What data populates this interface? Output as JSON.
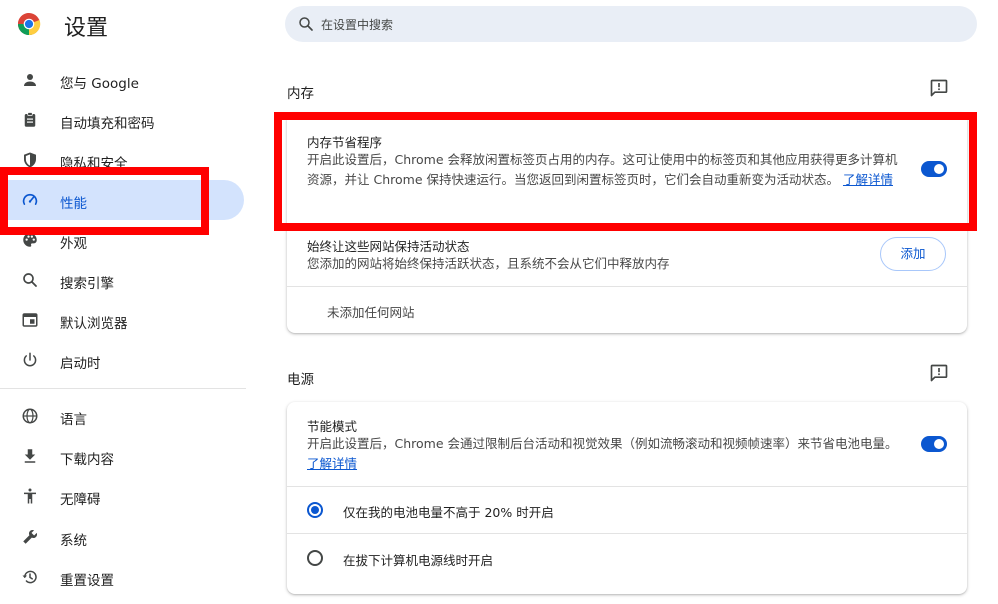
{
  "header": {
    "title": "设置",
    "search_placeholder": "在设置中搜索"
  },
  "sidebar": {
    "items": [
      {
        "label": "您与 Google",
        "icon": "person-icon"
      },
      {
        "label": "自动填充和密码",
        "icon": "clipboard-icon"
      },
      {
        "label": "隐私和安全",
        "icon": "shield-icon"
      },
      {
        "label": "性能",
        "icon": "speedometer-icon",
        "active": true
      },
      {
        "label": "外观",
        "icon": "palette-icon"
      },
      {
        "label": "搜索引擎",
        "icon": "search-icon"
      },
      {
        "label": "默认浏览器",
        "icon": "browser-window-icon"
      },
      {
        "label": "启动时",
        "icon": "power-icon"
      },
      {
        "label": "语言",
        "icon": "globe-icon"
      },
      {
        "label": "下载内容",
        "icon": "download-icon"
      },
      {
        "label": "无障碍",
        "icon": "accessibility-icon"
      },
      {
        "label": "系统",
        "icon": "wrench-icon"
      },
      {
        "label": "重置设置",
        "icon": "history-reset-icon"
      }
    ]
  },
  "memory": {
    "section_title": "内存",
    "saver": {
      "title": "内存节省程序",
      "description": "开启此设置后，Chrome 会释放闲置标签页占用的内存。这可让使用中的标签页和其他应用获得更多计算机资源，并让 Chrome 保持快速运行。当您返回到闲置标签页时，它们会自动重新变为活动状态。",
      "link": "了解详情",
      "enabled": true
    },
    "always_active": {
      "title": "始终让这些网站保持活动状态",
      "description": "您添加的网站将始终保持活跃状态，且系统不会从它们中释放内存",
      "add_label": "添加",
      "empty_text": "未添加任何网站"
    }
  },
  "power": {
    "section_title": "电源",
    "energy_saver": {
      "title": "节能模式",
      "description": "开启此设置后，Chrome 会通过限制后台活动和视觉效果（例如流畅滚动和视频帧速率）来节省电池电量。",
      "link": "了解详情",
      "enabled": true
    },
    "options": [
      {
        "label": "仅在我的电池电量不高于 20% 时开启",
        "checked": true
      },
      {
        "label": "在拔下计算机电源线时开启",
        "checked": false
      }
    ]
  },
  "colors": {
    "accent": "#0b57d0",
    "active_nav_bg": "#d3e3fd",
    "annotation_red": "#ff0000"
  }
}
